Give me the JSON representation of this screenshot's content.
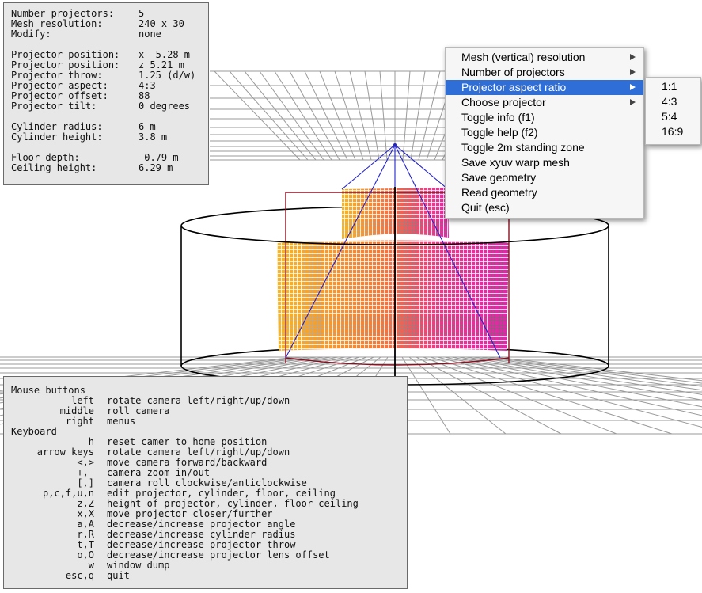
{
  "info": {
    "rows": [
      {
        "label": "Number projectors:",
        "value": "5"
      },
      {
        "label": "Mesh resolution:",
        "value": "240 x 30"
      },
      {
        "label": "Modify:",
        "value": "none"
      },
      null,
      {
        "label": "Projector position:",
        "value": "x -5.28 m"
      },
      {
        "label": "Projector position:",
        "value": "z 5.21 m"
      },
      {
        "label": "Projector throw:",
        "value": "1.25 (d/w)"
      },
      {
        "label": "Projector aspect:",
        "value": "4:3"
      },
      {
        "label": "Projector offset:",
        "value": "88"
      },
      {
        "label": "Projector tilt:",
        "value": "0 degrees"
      },
      null,
      {
        "label": "Cylinder radius:",
        "value": "6 m"
      },
      {
        "label": "Cylinder height:",
        "value": "3.8 m"
      },
      null,
      {
        "label": "Floor depth:",
        "value": "-0.79 m"
      },
      {
        "label": "Ceiling height:",
        "value": "6.29 m"
      }
    ]
  },
  "help": {
    "mouse_title": "Mouse buttons",
    "mouse": [
      {
        "key": "left",
        "desc": "rotate camera left/right/up/down"
      },
      {
        "key": "middle",
        "desc": "roll camera"
      },
      {
        "key": "right",
        "desc": "menus"
      }
    ],
    "keyboard_title": "Keyboard",
    "keyboard": [
      {
        "key": "h",
        "desc": "reset camer to home position"
      },
      {
        "key": "arrow keys",
        "desc": "rotate camera left/right/up/down"
      },
      {
        "key": "<,>",
        "desc": "move camera forward/backward"
      },
      {
        "key": "+,-",
        "desc": "camera zoom in/out"
      },
      {
        "key": "[,]",
        "desc": "camera roll clockwise/anticlockwise"
      },
      {
        "key": "p,c,f,u,n",
        "desc": "edit projector, cylinder, floor, ceiling"
      },
      {
        "key": "z,Z",
        "desc": "height of projector, cylinder, floor ceiling"
      },
      {
        "key": "x,X",
        "desc": "move projector closer/further"
      },
      {
        "key": "a,A",
        "desc": "decrease/increase projector angle"
      },
      {
        "key": "r,R",
        "desc": "decrease/increase cylinder radius"
      },
      {
        "key": "t,T",
        "desc": "decrease/increase projector throw"
      },
      {
        "key": "o,O",
        "desc": "decrease/increase projector lens offset"
      },
      {
        "key": "w",
        "desc": "window dump"
      },
      {
        "key": "esc,q",
        "desc": "quit"
      }
    ]
  },
  "menu": {
    "items": [
      {
        "label": "Mesh (vertical) resolution",
        "submenu": true,
        "selected": false
      },
      {
        "label": "Number of projectors",
        "submenu": true,
        "selected": false
      },
      {
        "label": "Projector aspect ratio",
        "submenu": true,
        "selected": true
      },
      {
        "label": "Choose projector",
        "submenu": true,
        "selected": false
      },
      {
        "label": "Toggle info (f1)",
        "submenu": false,
        "selected": false
      },
      {
        "label": "Toggle help (f2)",
        "submenu": false,
        "selected": false
      },
      {
        "label": "Toggle 2m standing zone",
        "submenu": false,
        "selected": false
      },
      {
        "label": "Save xyuv warp mesh",
        "submenu": false,
        "selected": false
      },
      {
        "label": "Save geometry",
        "submenu": false,
        "selected": false
      },
      {
        "label": "Read geometry",
        "submenu": false,
        "selected": false
      },
      {
        "label": "Quit (esc)",
        "submenu": false,
        "selected": false
      }
    ],
    "submenu_items": [
      "1:1",
      "4:3",
      "5:4",
      "16:9"
    ]
  },
  "colors": {
    "menu_highlight": "#2f6ed6",
    "panel_bg": "#e7e7e7",
    "cylinder_outline": "#000000",
    "frustum_lines": "#2222cc",
    "projection_box": "#8a1020",
    "mesh_orange": "#f5a623",
    "mesh_magenta": "#e0209a",
    "grid_lines": "#9a9a9a"
  }
}
